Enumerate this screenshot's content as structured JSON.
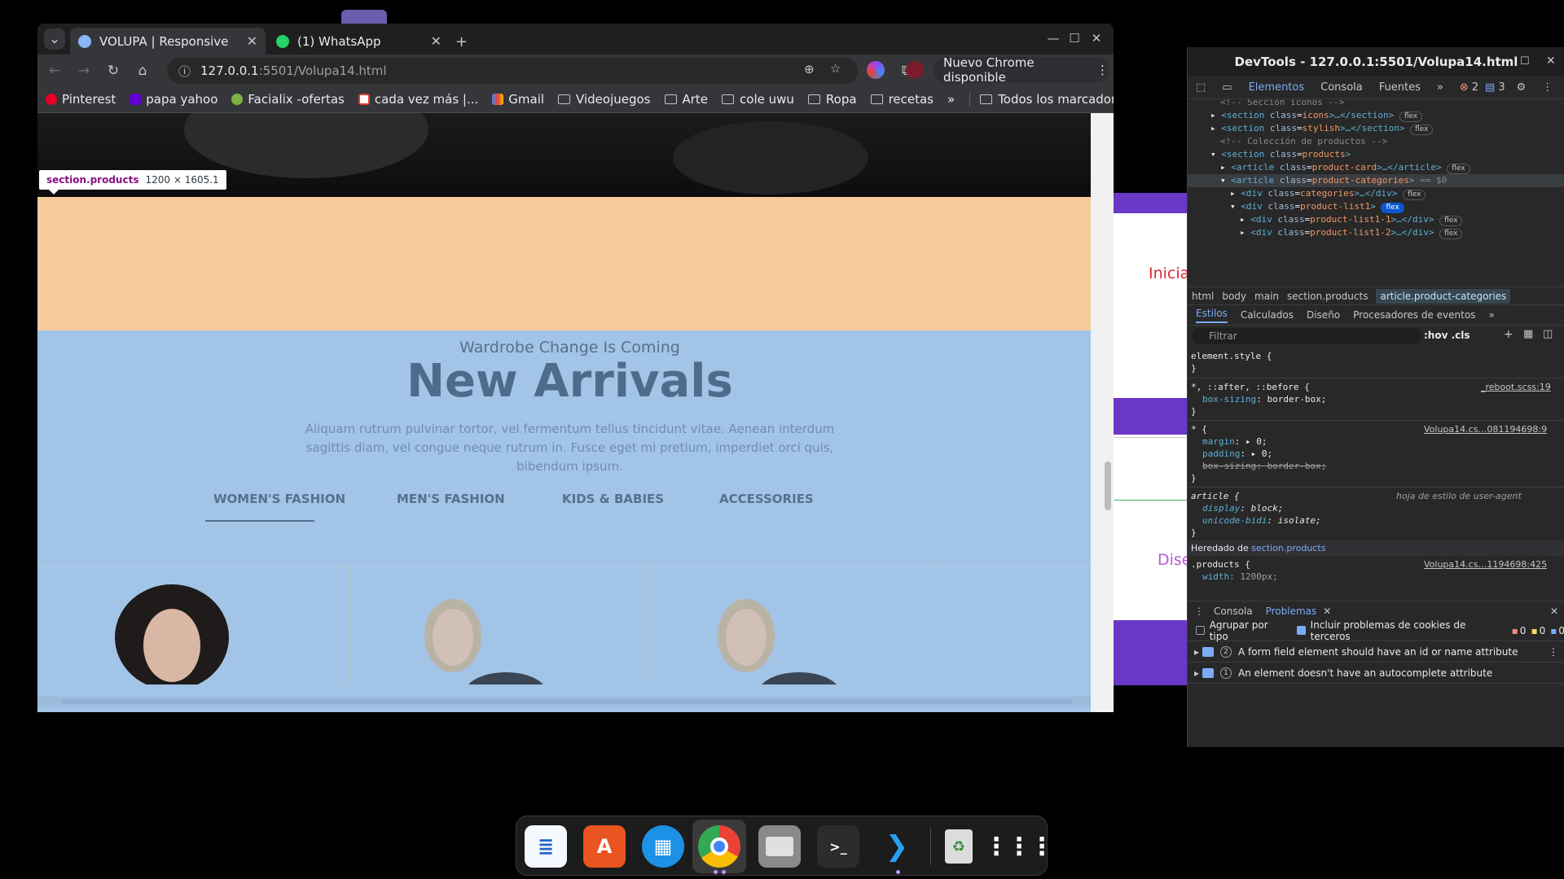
{
  "browser": {
    "tabs": [
      {
        "title": "VOLUPA | Responsive",
        "active": true
      },
      {
        "title": "(1) WhatsApp",
        "active": false
      }
    ],
    "new_tab_glyph": "+",
    "address": {
      "host": "127.0.0.1",
      "path": ":5501/Volupa14.html"
    },
    "update_button": "Nuevo Chrome disponible",
    "bookmarks": [
      {
        "label": "Pinterest",
        "icon": "pinterest-icon",
        "color": "#e60023"
      },
      {
        "label": "papa yahoo",
        "icon": "yahoo-icon",
        "color": "#6001d2"
      },
      {
        "label": "Facialix -ofertas",
        "icon": "facialix-icon",
        "color": "#7cb342"
      },
      {
        "label": "cada vez más |...",
        "icon": "site-icon",
        "color": "#e53935"
      },
      {
        "label": "Gmail",
        "icon": "gmail-icon",
        "color": "#ea4335"
      },
      {
        "label": "Videojuegos",
        "icon": "folder-icon"
      },
      {
        "label": "Arte",
        "icon": "folder-icon"
      },
      {
        "label": "cole uwu",
        "icon": "folder-icon"
      },
      {
        "label": "Ropa",
        "icon": "folder-icon"
      },
      {
        "label": "recetas",
        "icon": "folder-icon"
      }
    ],
    "bookmarks_overflow": "»",
    "all_bookmarks": "Todos los marcadores"
  },
  "page": {
    "tooltip": {
      "selector": "section.products",
      "size": "1200 × 1605.1"
    },
    "subtitle": "Wardrobe Change Is Coming",
    "heading": "New Arrivals",
    "intro": "Aliquam rutrum pulvinar tortor, vel fermentum tellus tincidunt vitae. Aenean interdum sagittis diam, vel congue neque rutrum in. Fusce eget mi pretium, imperdiet orci quis, bibendum ipsum.",
    "categories": [
      "WOMEN'S FASHION",
      "MEN'S FASHION",
      "KIDS & BABIES",
      "ACCESSORIES"
    ],
    "active_category": "WOMEN'S FASHION",
    "colors": {
      "margin_overlay": "#f6cb9c",
      "content_overlay": "#a2c4e6"
    }
  },
  "background_app": {
    "text_1": "Inicia",
    "text_2": "Dise",
    "accent": "#6a38c6"
  },
  "devtools": {
    "title": "DevTools - 127.0.0.1:5501/Volupa14.html",
    "tabs": [
      "Elementos",
      "Consola",
      "Fuentes"
    ],
    "tabs_more": "»",
    "error_count": "2",
    "message_count": "3",
    "dom": [
      {
        "text": "<!-- Sección iconos -->",
        "kind": "comment"
      },
      {
        "tag": "section",
        "attr": "class",
        "val": "icons",
        "flex": "flex"
      },
      {
        "tag": "section",
        "attr": "class",
        "val": "stylish",
        "flex": "flex"
      },
      {
        "text": "<!-- Colección de productos -->",
        "kind": "comment"
      },
      {
        "tag": "section",
        "attr": "class",
        "val": "products",
        "open": true
      },
      {
        "tag": "article",
        "attr": "class",
        "val": "product-card",
        "flex": "flex"
      },
      {
        "tag": "article",
        "attr": "class",
        "val": "product-categories",
        "suffix": "== $0",
        "selected": true
      },
      {
        "tag": "div",
        "attr": "class",
        "val": "categories",
        "flex": "flex"
      },
      {
        "tag": "div",
        "attr": "class",
        "val": "product-list1",
        "flex": "flex",
        "open": true
      },
      {
        "tag": "div",
        "attr": "class",
        "val": "product-list1-1",
        "flex": "flex"
      },
      {
        "tag": "div",
        "attr": "class",
        "val": "product-list1-2",
        "flex": "flex"
      }
    ],
    "breadcrumbs": [
      "html",
      "body",
      "main",
      "section.products",
      "article.product-categories"
    ],
    "style_tabs": [
      "Estilos",
      "Calculados",
      "Diseño",
      "Procesadores de eventos"
    ],
    "filter_placeholder": "Filtrar",
    "filter_tools": ":hov  .cls",
    "rules": {
      "element_style": "element.style {",
      "reboot_selector": "*, ::after, ::before {",
      "reboot_source": "_reboot.scss:19",
      "reboot_prop": "box-sizing",
      "reboot_val": "border-box;",
      "star_selector": "* {",
      "star_source": "Volupa14.cs…081194698:9",
      "margin_prop": "margin",
      "margin_val": "▸ 0;",
      "padding_prop": "padding",
      "padding_val": "▸ 0;",
      "boxsizing_struck": "box-sizing: border-box;",
      "article_selector": "article {",
      "article_source": "hoja de estilo de user-agent",
      "display_prop": "display",
      "display_val": "block;",
      "bidi_prop": "unicode-bidi",
      "bidi_val": "isolate;",
      "inherited_label": "Heredado de",
      "inherited_from": "section.products",
      "products_selector": ".products {",
      "products_source": "Volupa14.cs…1194698:425",
      "width_prop": "width",
      "width_val": "1200px;"
    },
    "drawer_tabs": [
      "Consola",
      "Problemas"
    ],
    "group_by_type": "Agrupar por tipo",
    "third_party": "Incluir problemas de cookies de terceros",
    "issue_counts": [
      "0",
      "0",
      "0"
    ],
    "issues": [
      {
        "count": "2",
        "text": "A form field element should have an id or name attribute"
      },
      {
        "count": "1",
        "text": "An element doesn't have an autocomplete attribute"
      }
    ]
  },
  "dock": {
    "apps": [
      "document-app-icon",
      "app-store-icon",
      "docker-icon",
      "chrome-icon",
      "files-icon",
      "terminal-icon",
      "vscode-icon",
      "trash-icon",
      "app-grid-icon"
    ],
    "terminal_glyph": ">_"
  }
}
